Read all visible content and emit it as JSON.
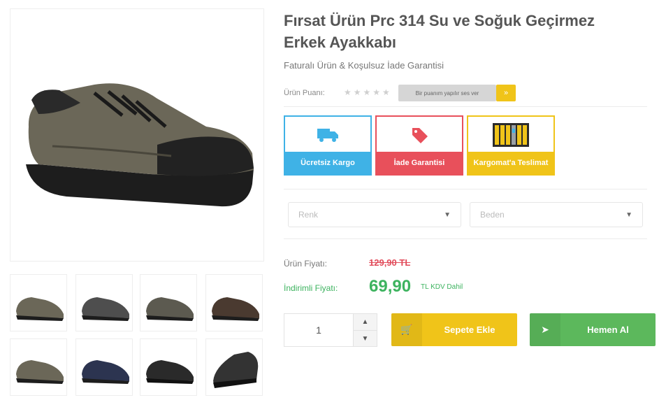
{
  "product": {
    "title": "Fırsat Ürün Prc 314 Su ve Soğuk Geçirmez Erkek Ayakkabı",
    "subtitle": "Faturalı Ürün & Koşulsuz İade Garantisi"
  },
  "gallery": {
    "thumb_tags": [
      "",
      "",
      "",
      "",
      "",
      "",
      "",
      ""
    ]
  },
  "rating": {
    "label": "Ürün Puanı:",
    "stars": "★★★★★",
    "vote_button": "Bir puanım yapılır ses ver",
    "vote_go": "»"
  },
  "features": [
    {
      "label": "Ücretsiz Kargo",
      "icon": "truck-icon",
      "color": "#3fb2e6"
    },
    {
      "label": "İade Garantisi",
      "icon": "tag-icon",
      "color": "#e8505b"
    },
    {
      "label": "Kargomat'a Teslimat",
      "icon": "locker-icon",
      "color": "#f0c419"
    }
  ],
  "selects": {
    "color_placeholder": "Renk",
    "size_placeholder": "Beden",
    "caret": "▼"
  },
  "pricing": {
    "old_label": "Ürün Fiyatı:",
    "old_price": "129,90 TL",
    "new_label": "İndirimli Fiyatı:",
    "new_price": "69,90",
    "new_tail": "TL KDV Dahil"
  },
  "quantity": {
    "value": "1",
    "up": "▲",
    "down": "▼"
  },
  "actions": {
    "cart_label": "Sepete Ekle",
    "cart_icon": "🛒",
    "buy_label": "Hemen Al",
    "buy_icon": "➤"
  },
  "colors": {
    "yellow": "#f0c419",
    "green": "#5cb85c",
    "blue": "#3fb2e6",
    "red": "#e8505b",
    "price_green": "#3db35f",
    "price_red": "#e14b5a"
  }
}
